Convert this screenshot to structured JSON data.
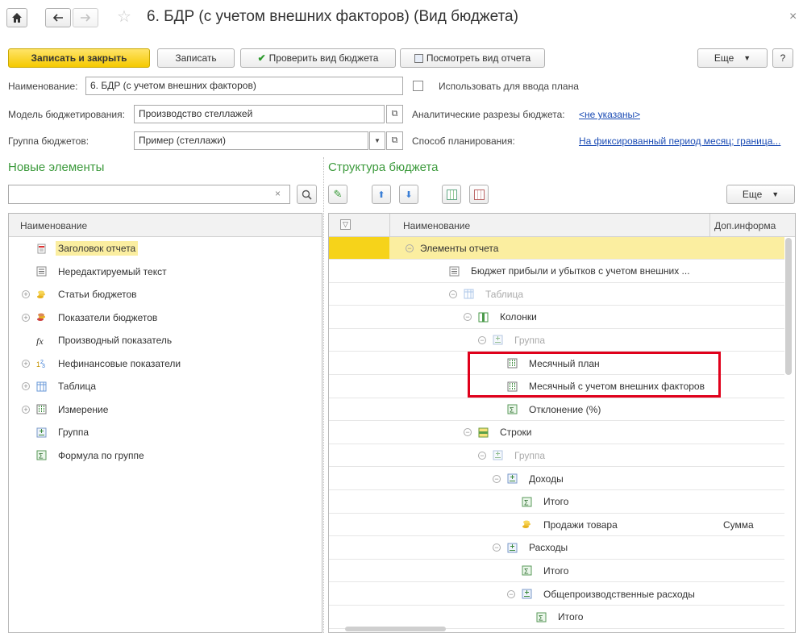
{
  "window": {
    "title": "6. БДР (с учетом внешних факторов) (Вид бюджета)",
    "close": "×"
  },
  "toolbar": {
    "save_close": "Записать и закрыть",
    "save": "Записать",
    "check": "Проверить вид бюджета",
    "view_report": "Посмотреть вид отчета",
    "more": "Еще",
    "help": "?"
  },
  "form": {
    "name_label": "Наименование:",
    "name_value": "6. БДР (с учетом внешних факторов)",
    "use_for_plan_label": "Использовать для ввода плана",
    "model_label": "Модель бюджетирования:",
    "model_value": "Производство стеллажей",
    "sections_label": "Аналитические разрезы бюджета:",
    "sections_value": "<не указаны>",
    "group_label": "Группа бюджетов:",
    "group_value": "Пример (стеллажи)",
    "method_label": "Способ планирования:",
    "method_value": "На фиксированный период месяц; граница..."
  },
  "left_panel": {
    "title": "Новые элементы",
    "search_placeholder": "",
    "clear": "×",
    "column_header": "Наименование",
    "items": [
      {
        "label": "Заголовок отчета",
        "icon": "report-header-icon",
        "expand": ""
      },
      {
        "label": "Нередактируемый текст",
        "icon": "text-icon",
        "expand": ""
      },
      {
        "label": "Статьи бюджетов",
        "icon": "coins-icon",
        "expand": "+"
      },
      {
        "label": "Показатели бюджетов",
        "icon": "coins-red-icon",
        "expand": "+"
      },
      {
        "label": "Производный показатель",
        "icon": "fx-icon",
        "expand": ""
      },
      {
        "label": "Нефинансовые показатели",
        "icon": "numbers-icon",
        "expand": "+"
      },
      {
        "label": "Таблица",
        "icon": "table-icon",
        "expand": "+"
      },
      {
        "label": "Измерение",
        "icon": "dimension-icon",
        "expand": "+"
      },
      {
        "label": "Группа",
        "icon": "group-icon",
        "expand": ""
      },
      {
        "label": "Формула по группе",
        "icon": "sigma-icon",
        "expand": ""
      }
    ]
  },
  "right_panel": {
    "title": "Структура бюджета",
    "more": "Еще",
    "col_name": "Наименование",
    "col_info": "Доп.информа",
    "rows": [
      {
        "label": "Элементы отчета",
        "icon": "",
        "expand": "−",
        "info": "",
        "gray": false
      },
      {
        "label": "Бюджет прибыли и убытков с учетом внешних ...",
        "icon": "text-icon",
        "expand": "",
        "info": "",
        "gray": false
      },
      {
        "label": "Таблица",
        "icon": "table-icon",
        "expand": "−",
        "info": "",
        "gray": true
      },
      {
        "label": "Колонки",
        "icon": "columns-icon",
        "expand": "−",
        "info": "",
        "gray": false
      },
      {
        "label": "Группа",
        "icon": "group-icon",
        "expand": "−",
        "info": "",
        "gray": true
      },
      {
        "label": "Месячный план",
        "icon": "dimension-icon",
        "expand": "",
        "info": "",
        "gray": false
      },
      {
        "label": "Месячный с учетом внешних факторов",
        "icon": "dimension-icon",
        "expand": "",
        "info": "",
        "gray": false
      },
      {
        "label": "Отклонение (%)",
        "icon": "sigma-icon",
        "expand": "",
        "info": "",
        "gray": false
      },
      {
        "label": "Строки",
        "icon": "rows-icon",
        "expand": "−",
        "info": "",
        "gray": false
      },
      {
        "label": "Группа",
        "icon": "group-icon",
        "expand": "−",
        "info": "",
        "gray": true
      },
      {
        "label": "Доходы",
        "icon": "group-icon",
        "expand": "−",
        "info": "",
        "gray": false
      },
      {
        "label": "Итого",
        "icon": "sigma-icon",
        "expand": "",
        "info": "",
        "gray": false
      },
      {
        "label": "Продажи товара",
        "icon": "coins-icon",
        "expand": "",
        "info": "Сумма",
        "gray": false
      },
      {
        "label": "Расходы",
        "icon": "group-icon",
        "expand": "−",
        "info": "",
        "gray": false
      },
      {
        "label": "Итого",
        "icon": "sigma-icon",
        "expand": "",
        "info": "",
        "gray": false
      },
      {
        "label": "Общепроизводственные расходы",
        "icon": "group-icon",
        "expand": "−",
        "info": "",
        "gray": false
      },
      {
        "label": "Итого",
        "icon": "sigma-icon",
        "expand": "",
        "info": "",
        "gray": false
      }
    ]
  },
  "colors": {
    "accent_green": "#3c9a3c",
    "selection_yellow": "#fbeea0",
    "highlight_red": "#e0001b",
    "link_blue": "#1a4bb4"
  }
}
